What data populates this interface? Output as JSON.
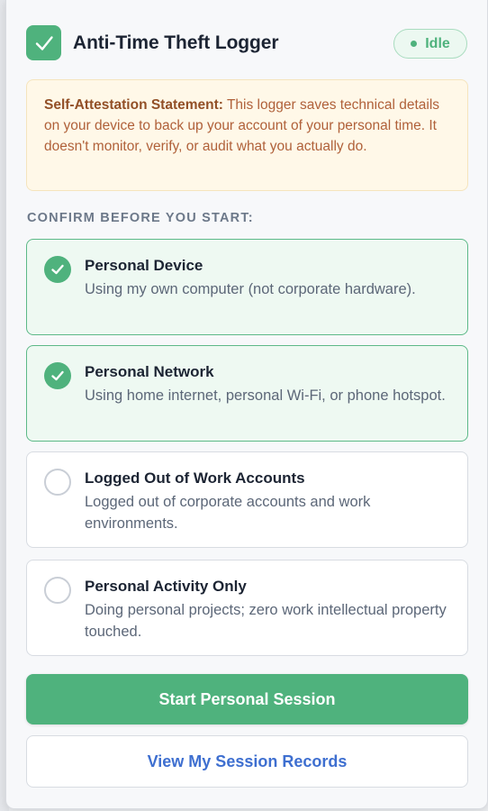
{
  "header": {
    "title": "Anti-Time Theft Logger",
    "status": "Idle"
  },
  "notice": {
    "heading": "Self-Attestation Statement:",
    "body": "This logger saves technical details on your device to back up your account of your personal time. It doesn't monitor, verify, or audit what you actually do."
  },
  "section_label": "CONFIRM BEFORE YOU START:",
  "options": [
    {
      "title": "Personal Device",
      "description": "Using my own computer (not corporate hardware).",
      "checked": true
    },
    {
      "title": "Personal Network",
      "description": "Using home internet, personal Wi-Fi, or phone hotspot.",
      "checked": true
    },
    {
      "title": "Logged Out of Work Accounts",
      "description": "Logged out of corporate accounts and work environments.",
      "checked": false
    },
    {
      "title": "Personal Activity Only",
      "description": "Doing personal projects; zero work intellectual property touched.",
      "checked": false
    }
  ],
  "buttons": {
    "start": "Start Personal Session",
    "records": "View My Session Records"
  },
  "colors": {
    "accent": "#4fb27d",
    "link": "#3e6fd0",
    "notice_bg": "#fff8e8"
  }
}
